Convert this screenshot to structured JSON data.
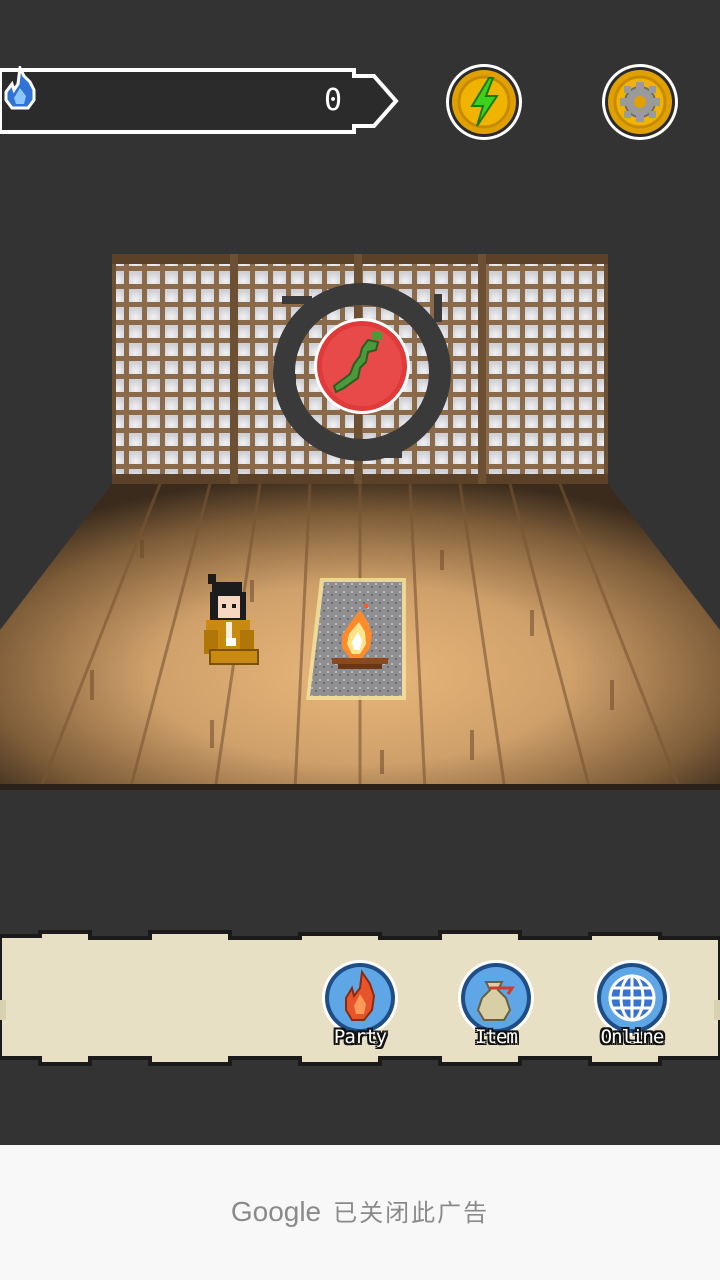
{
  "hud": {
    "currency_icon": "blue-flame-icon",
    "currency_value": "0",
    "energy_icon": "lightning-bolt-icon",
    "settings_icon": "gear-icon"
  },
  "scene": {
    "emblem_icon": "japan-map-icon",
    "character": "samurai-character",
    "campfire": "campfire-icon"
  },
  "menu": {
    "items": [
      {
        "label": "Party",
        "icon": "flame-icon"
      },
      {
        "label": "Item",
        "icon": "item-bag-icon"
      },
      {
        "label": "Online",
        "icon": "globe-icon"
      }
    ]
  },
  "ad": {
    "brand": "Google",
    "message": "已关闭此广告"
  },
  "colors": {
    "background": "#333333",
    "gold": "#e0a000",
    "energy_green": "#3bd11e",
    "menu_paper": "#e8e0c4",
    "button_blue": "#5ea6e6",
    "emblem_red": "#e03a3a"
  }
}
